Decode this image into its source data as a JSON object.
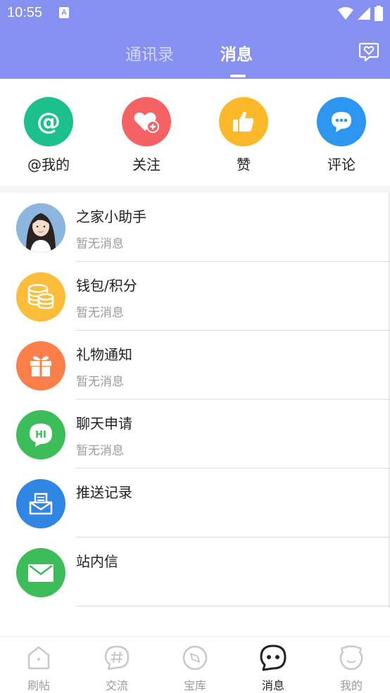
{
  "status_bar": {
    "time": "10:55",
    "notification_letter": "A"
  },
  "header": {
    "tabs": [
      {
        "label": "通讯录",
        "active": false
      },
      {
        "label": "消息",
        "active": true
      }
    ],
    "right_icon": "chat-heart-icon"
  },
  "quick_actions": [
    {
      "label": "@我的",
      "icon": "at-icon",
      "color": "#1dbf8c"
    },
    {
      "label": "关注",
      "icon": "heart-plus-icon",
      "color": "#f56263"
    },
    {
      "label": "赞",
      "icon": "thumbs-up-icon",
      "color": "#fbb829"
    },
    {
      "label": "评论",
      "icon": "comment-icon",
      "color": "#2d96f0"
    }
  ],
  "messages": [
    {
      "title": "之家小助手",
      "subtitle": "暂无消息",
      "icon": "assistant-avatar"
    },
    {
      "title": "钱包/积分",
      "subtitle": "暂无消息",
      "icon": "coins-icon",
      "color": "#fbbd3a"
    },
    {
      "title": "礼物通知",
      "subtitle": "暂无消息",
      "icon": "gift-icon",
      "color": "#fa7f4b"
    },
    {
      "title": "聊天申请",
      "subtitle": "暂无消息",
      "icon": "hi-bubble-icon",
      "color": "#3cbd5a"
    },
    {
      "title": "推送记录",
      "subtitle": "",
      "icon": "push-inbox-icon",
      "color": "#2f86e3"
    },
    {
      "title": "站内信",
      "subtitle": "",
      "icon": "envelope-icon",
      "color": "#3cbd5a"
    }
  ],
  "bottom_nav": [
    {
      "label": "刷帖",
      "icon": "house-icon",
      "active": false
    },
    {
      "label": "交流",
      "icon": "hashtag-bubble-icon",
      "active": false
    },
    {
      "label": "宝库",
      "icon": "compass-icon",
      "active": false
    },
    {
      "label": "消息",
      "icon": "message-face-icon",
      "active": true
    },
    {
      "label": "我的",
      "icon": "profile-face-icon",
      "active": false
    }
  ]
}
